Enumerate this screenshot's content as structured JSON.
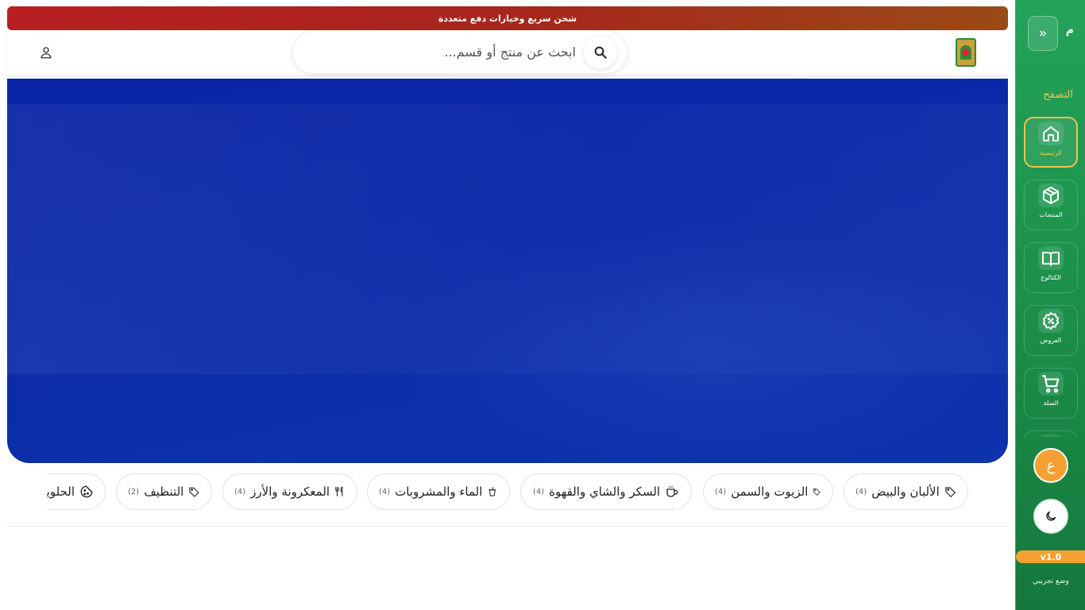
{
  "announcement": {
    "text": "شحن سريع وخيارات دفع متعددة"
  },
  "header": {
    "search_placeholder": "ابحث عن منتج أو قسم..."
  },
  "sidebar": {
    "brand": "م",
    "section_title": "التصفح",
    "items": [
      {
        "label": "الرئيسية",
        "icon": "home-icon",
        "active": true
      },
      {
        "label": "المنتجات",
        "icon": "box-icon",
        "active": false
      },
      {
        "label": "الكتالوج",
        "icon": "book-icon",
        "active": false
      },
      {
        "label": "العروض",
        "icon": "discount-badge-icon",
        "active": false
      },
      {
        "label": "السلة",
        "icon": "cart-icon",
        "active": false
      }
    ],
    "orange_button_label": "ع",
    "version": "v1.0",
    "mode": "وضع تجريبي"
  },
  "categories": [
    {
      "label": "الألبان والبيض",
      "count": "(4)",
      "icon": "tag-icon"
    },
    {
      "label": "الزيوت والسمن",
      "count": "(4)",
      "icon": "tag-icon"
    },
    {
      "label": "السكر والشاي والقهوة",
      "count": "(4)",
      "icon": "coffee-cup-icon"
    },
    {
      "label": "الماء والمشروبات",
      "count": "(4)",
      "icon": "drink-cup-icon"
    },
    {
      "label": "المعكرونة والأرز",
      "count": "(4)",
      "icon": "utensils-icon"
    },
    {
      "label": "التنظيف",
      "count": "(2)",
      "icon": "tag-icon"
    },
    {
      "label": "الحلويات",
      "count": "",
      "icon": "cookie-icon"
    }
  ],
  "colors": {
    "sidebar_green": "#1b8d49",
    "accent_orange": "#f5a132",
    "accent_gold": "#f3c34b",
    "hero_blue": "#0b2aa9",
    "announce_red": "#b81f22"
  }
}
